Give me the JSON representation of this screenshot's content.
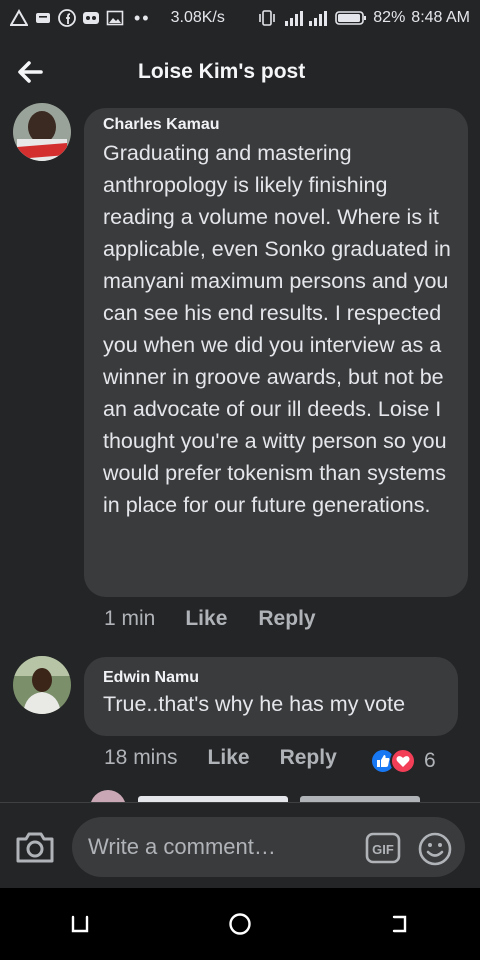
{
  "status_bar": {
    "speed": "3.08K/s",
    "battery": "82%",
    "time": "8:48 AM",
    "icons": [
      "alert-icon",
      "message-icon",
      "facebook-icon",
      "game-icon",
      "image-icon",
      "more-dots-icon",
      "vibrate-icon",
      "signal-icon",
      "battery-icon"
    ]
  },
  "header": {
    "title": "Loise Kim's post"
  },
  "comments": [
    {
      "author": "Charles Kamau",
      "text": "Graduating and mastering anthropology is likely finishing reading a volume novel. Where is it applicable, even Sonko graduated in manyani maximum persons and you can see his end results. I respected you when we did you interview as a winner in groove awards, but not be an advocate of our ill deeds. Loise I thought you're a witty person so you would prefer tokenism than systems in place for our future generations.",
      "time": "1 min",
      "like_label": "Like",
      "reply_label": "Reply"
    },
    {
      "author": "Edwin Namu",
      "text": "True..that's why he has my vote",
      "time": "18 mins",
      "like_label": "Like",
      "reply_label": "Reply",
      "reaction_count": "6",
      "reactions": [
        "like-reaction-icon",
        "love-reaction-icon"
      ]
    }
  ],
  "composer": {
    "placeholder": "Write a comment…"
  },
  "colors": {
    "background": "#242526",
    "bubble": "#3a3b3c",
    "like_blue": "#1877f2",
    "love_red": "#f33e58"
  }
}
